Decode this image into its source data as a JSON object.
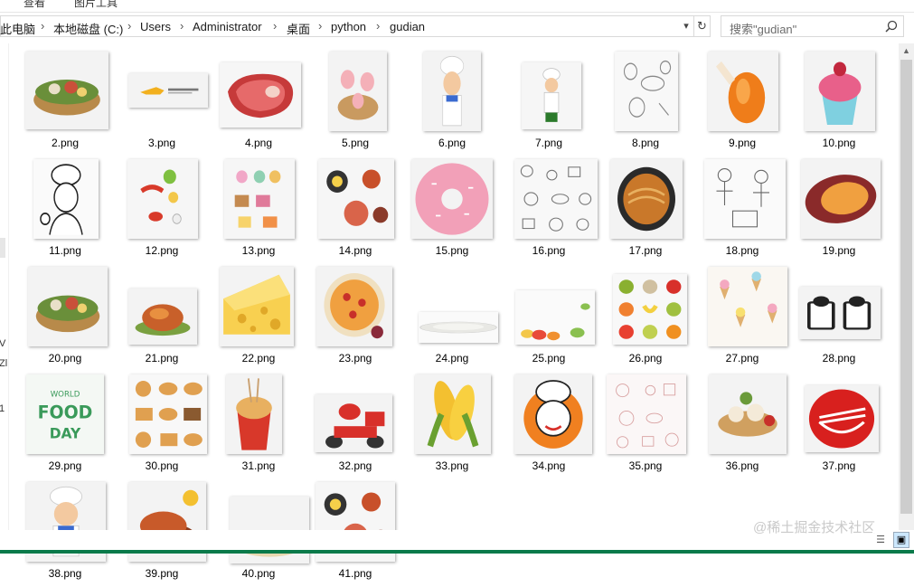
{
  "ribbon": {
    "items": [
      "查看",
      "图片工具"
    ]
  },
  "breadcrumb": [
    "此电脑",
    "本地磁盘 (C:)",
    "Users",
    "Administrator",
    "桌面",
    "python",
    "gudian"
  ],
  "search": {
    "placeholder": "搜索\"gudian\""
  },
  "nav_fragments": [
    "V",
    "Zl",
    "1"
  ],
  "files": [
    {
      "label": "2.png",
      "icon": "hotpot-icon"
    },
    {
      "label": "3.png",
      "icon": "delivery-logo-icon"
    },
    {
      "label": "4.png",
      "icon": "steak-icon"
    },
    {
      "label": "5.png",
      "icon": "pig-dessert-icon"
    },
    {
      "label": "6.png",
      "icon": "chef-icon"
    },
    {
      "label": "7.png",
      "icon": "chef-small-icon"
    },
    {
      "label": "8.png",
      "icon": "sketch-food-icon"
    },
    {
      "label": "9.png",
      "icon": "chicken-leg-icon"
    },
    {
      "label": "10.png",
      "icon": "cupcake-icon"
    },
    {
      "label": "11.png",
      "icon": "chef-sketch-icon"
    },
    {
      "label": "12.png",
      "icon": "vegetables-icon"
    },
    {
      "label": "13.png",
      "icon": "desserts-icon"
    },
    {
      "label": "14.png",
      "icon": "dishes-icon"
    },
    {
      "label": "15.png",
      "icon": "donut-icon"
    },
    {
      "label": "16.png",
      "icon": "doodle-pattern-icon"
    },
    {
      "label": "17.png",
      "icon": "noodle-bowl-icon"
    },
    {
      "label": "18.png",
      "icon": "sketch-people-icon"
    },
    {
      "label": "19.png",
      "icon": "sweet-potato-icon"
    },
    {
      "label": "20.png",
      "icon": "hotpot-icon"
    },
    {
      "label": "21.png",
      "icon": "roast-chicken-icon"
    },
    {
      "label": "22.png",
      "icon": "cheese-icon"
    },
    {
      "label": "23.png",
      "icon": "pizza-icon"
    },
    {
      "label": "24.png",
      "icon": "plate-icon"
    },
    {
      "label": "25.png",
      "icon": "fruit-border-icon"
    },
    {
      "label": "26.png",
      "icon": "fruits-grid-icon"
    },
    {
      "label": "27.png",
      "icon": "ice-cream-pattern-icon"
    },
    {
      "label": "28.png",
      "icon": "beer-mugs-icon"
    },
    {
      "label": "29.png",
      "icon": "world-food-day-icon"
    },
    {
      "label": "30.png",
      "icon": "bread-grid-icon"
    },
    {
      "label": "31.png",
      "icon": "noodle-box-icon"
    },
    {
      "label": "32.png",
      "icon": "delivery-rider-icon"
    },
    {
      "label": "33.png",
      "icon": "corn-icon"
    },
    {
      "label": "34.png",
      "icon": "chef-badge-icon"
    },
    {
      "label": "35.png",
      "icon": "line-pattern-icon"
    },
    {
      "label": "36.png",
      "icon": "dim-sum-icon"
    },
    {
      "label": "37.png",
      "icon": "noodle-logo-icon"
    },
    {
      "label": "38.png",
      "icon": "chef-icon"
    },
    {
      "label": "39.png",
      "icon": "roast-icon"
    },
    {
      "label": "40.png",
      "icon": "ramen-icon"
    },
    {
      "label": "41.png",
      "icon": "dishes-icon"
    }
  ],
  "watermark": "@稀土掘金技术社区",
  "colors": {
    "accent": "#0a7a4a",
    "scrollbar": "#cdcdcd"
  }
}
